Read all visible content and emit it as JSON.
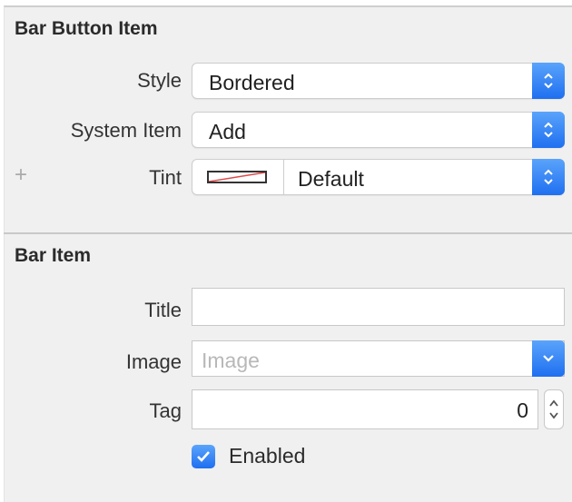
{
  "bar_button_item": {
    "section_title": "Bar Button Item",
    "style": {
      "label": "Style",
      "value": "Bordered"
    },
    "system_item": {
      "label": "System Item",
      "value": "Add"
    },
    "tint": {
      "label": "Tint",
      "value": "Default",
      "add_symbol": "+"
    }
  },
  "bar_item": {
    "section_title": "Bar Item",
    "title": {
      "label": "Title",
      "value": ""
    },
    "image": {
      "label": "Image",
      "placeholder": "Image"
    },
    "tag": {
      "label": "Tag",
      "value": "0"
    },
    "enabled": {
      "label": "Enabled",
      "checked": true
    }
  },
  "colors": {
    "accent": "#2a7ff5",
    "panel_bg": "#f0f0f0"
  }
}
